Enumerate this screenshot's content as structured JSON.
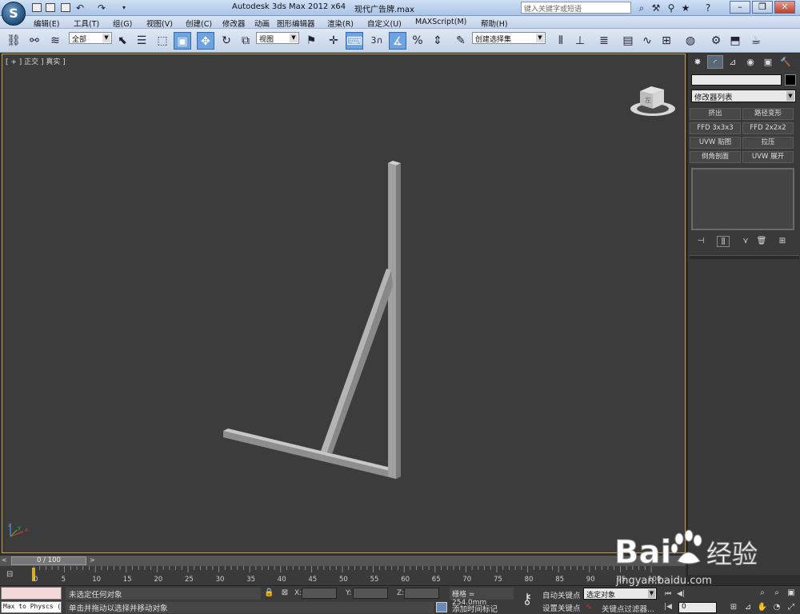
{
  "titlebar": {
    "app_logo": "S",
    "title": "Autodesk 3ds Max  2012 x64",
    "file": "现代广告牌.max",
    "search_placeholder": "键入关键字或短语"
  },
  "menu": [
    "编辑(E)",
    "工具(T)",
    "组(G)",
    "视图(V)",
    "创建(C)",
    "修改器",
    "动画",
    "图形编辑器",
    "渲染(R)",
    "自定义(U)",
    "MAXScript(M)",
    "帮助(H)"
  ],
  "toolbar": {
    "selection_filter": "全部",
    "ref_coord": "视图",
    "named_selection": "创建选择集",
    "snap_label": "3"
  },
  "viewport": {
    "label": "[ + ] 正交 ] 真实 ]",
    "viewcube_label": "左"
  },
  "command_panel": {
    "modifier_list": "修改器列表",
    "modifier_buttons": [
      "挤出",
      "路径变形",
      "FFD 3x3x3",
      "FFD 2x2x2",
      "UVW 贴图",
      "拉压",
      "倒角剖面",
      "UVW 展开"
    ]
  },
  "timeline": {
    "position": "0 / 100",
    "ticks": [
      "0",
      "5",
      "10",
      "15",
      "20",
      "25",
      "30",
      "35",
      "40",
      "45",
      "50",
      "55",
      "60",
      "65",
      "70",
      "75",
      "80",
      "85",
      "90",
      "95",
      "100"
    ]
  },
  "status": {
    "maxscript_listener": "Max to Physcs (",
    "selection": "未选定任何对象",
    "prompt": "单击并拖动以选择并移动对象",
    "x_label": "X:",
    "y_label": "Y:",
    "z_label": "Z:",
    "grid": "栅格 = 254.0mm",
    "add_time_tag": "添加时间标记",
    "auto_key": "自动关键点",
    "set_key": "设置关键点",
    "selected_set": "选定对象",
    "key_filters": "关键点过滤器...",
    "frame": "0"
  },
  "watermark": {
    "brand_left": "Bai",
    "brand_right": "经验",
    "url": "jingyan.baidu.com"
  }
}
